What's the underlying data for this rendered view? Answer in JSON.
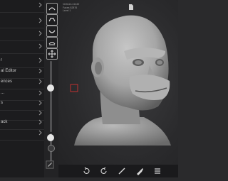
{
  "menu": {
    "items": [
      {
        "label": ""
      },
      {
        "label": ""
      },
      {
        "label": ""
      },
      {
        "label": ""
      },
      {
        "label": "r"
      },
      {
        "label": "al Editor"
      },
      {
        "label": "ences"
      },
      {
        "label": "..."
      },
      {
        "label": "s"
      },
      {
        "label": ""
      },
      {
        "label": "ack"
      },
      {
        "label": ""
      }
    ]
  },
  "stats": {
    "line1": "Vertices 41440",
    "line2": "Faces 82876",
    "line3": "Level 1"
  },
  "colors": {
    "panel": "#1c1c1e",
    "viewport": "#2a2a2c",
    "model": "#a9a9a9",
    "selection_marker": "#c03030"
  },
  "icons": {
    "tools": [
      "standard-brush-icon",
      "clay-brush-icon",
      "crease-brush-icon",
      "flatten-brush-icon",
      "move-icon"
    ],
    "bottom": [
      "undo-icon",
      "redo-icon",
      "refresh-icon",
      "stroke-icon",
      "paint-icon",
      "layers-icon"
    ]
  }
}
